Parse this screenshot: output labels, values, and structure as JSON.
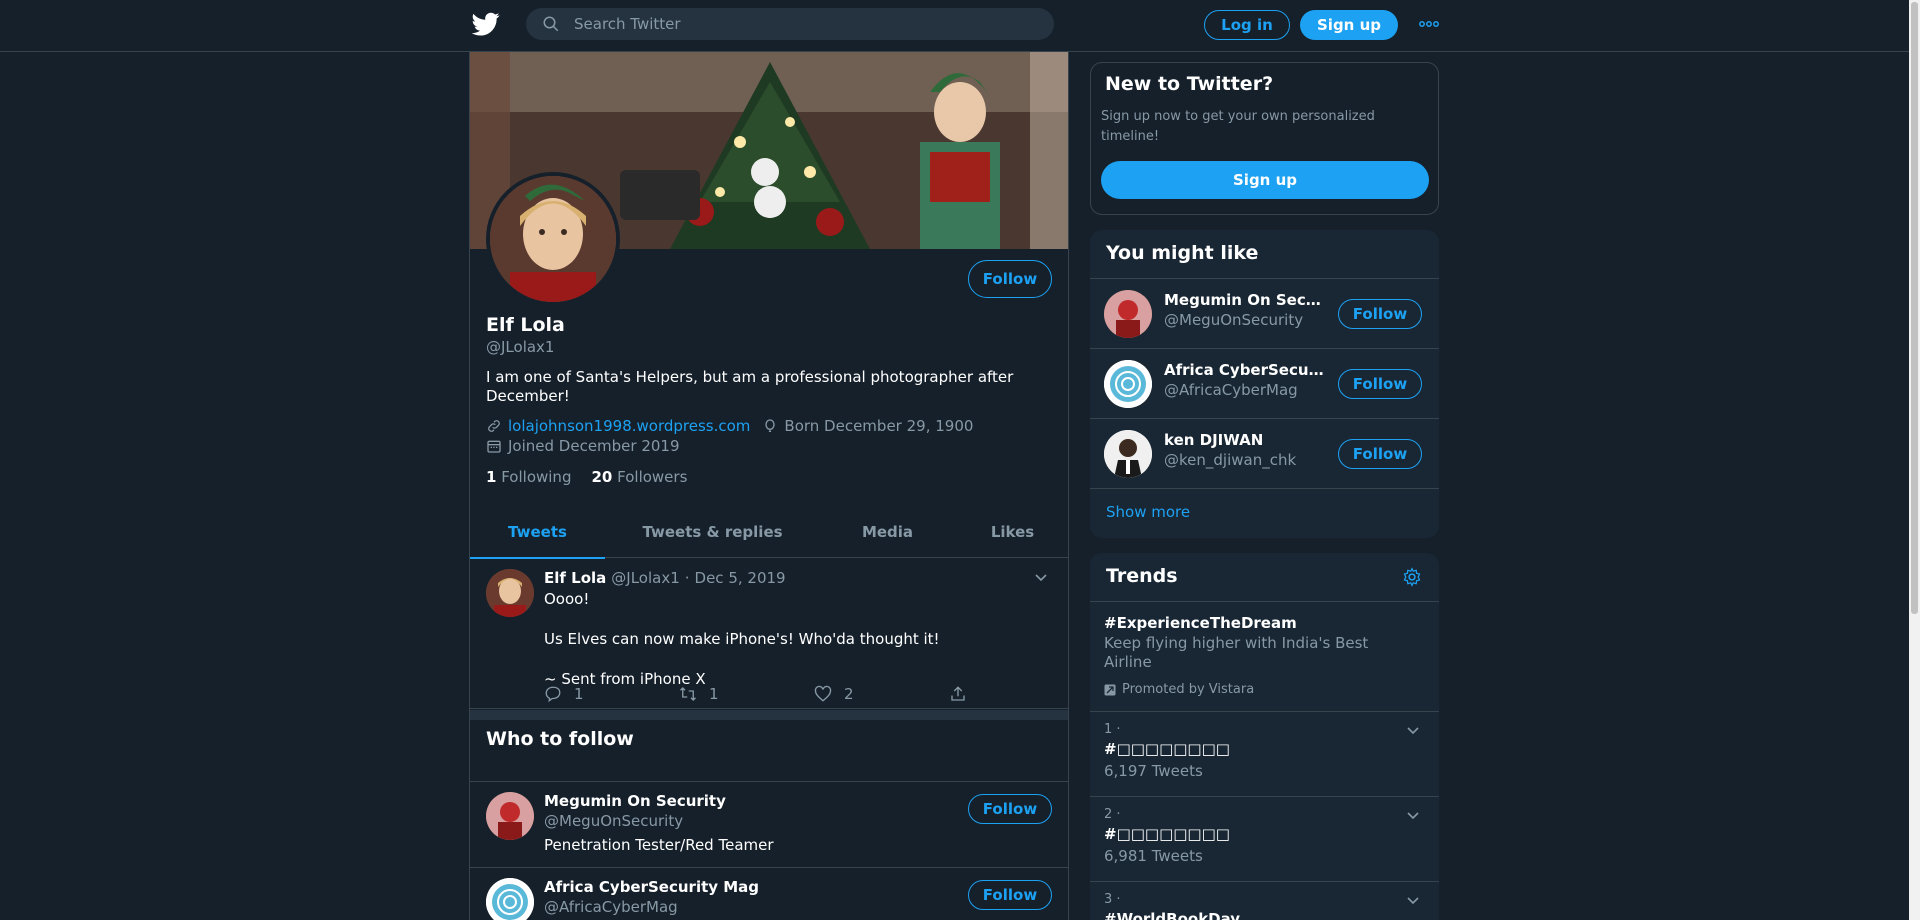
{
  "header": {
    "search_placeholder": "Search Twitter",
    "login_label": "Log in",
    "signup_label": "Sign up"
  },
  "profile": {
    "name": "Elf Lola",
    "handle": "@JLolax1",
    "follow_label": "Follow",
    "bio": "I am one of Santa's Helpers, but am a professional photographer after December!",
    "website": "lolajohnson1998.wordpress.com",
    "born": "Born December 29, 1900",
    "joined": "Joined December 2019",
    "following_count": "1",
    "following_label": "Following",
    "followers_count": "20",
    "followers_label": "Followers"
  },
  "tabs": [
    {
      "label": "Tweets",
      "active": true
    },
    {
      "label": "Tweets & replies",
      "active": false
    },
    {
      "label": "Media",
      "active": false
    },
    {
      "label": "Likes",
      "active": false
    }
  ],
  "tweet": {
    "name": "Elf Lola",
    "handle": "@JLolax1",
    "sep": "·",
    "date": "Dec 5, 2019",
    "lines": [
      "Oooo!",
      "Us Elves can now make iPhone's! Who'da thought it!",
      "~ Sent from iPhone X"
    ],
    "replies": "1",
    "retweets": "1",
    "likes": "2"
  },
  "who_to_follow": {
    "title": "Who to follow",
    "items": [
      {
        "name": "Megumin On Security",
        "handle": "@MeguOnSecurity",
        "desc": "Penetration Tester/Red Teamer",
        "follow": "Follow"
      },
      {
        "name": "Africa CyberSecurity Mag",
        "handle": "@AfricaCyberMag",
        "desc": "",
        "follow": "Follow"
      }
    ]
  },
  "new_to_twitter": {
    "title": "New to Twitter?",
    "text": "Sign up now to get your own personalized timeline!",
    "signup_label": "Sign up"
  },
  "you_might_like": {
    "title": "You might like",
    "items": [
      {
        "name": "Megumin On Security",
        "handle": "@MeguOnSecurity",
        "follow": "Follow"
      },
      {
        "name": "Africa CyberSecurity Mag",
        "handle": "@AfricaCyberMag",
        "follow": "Follow"
      },
      {
        "name": "ken DJIWAN",
        "handle": "@ken_djiwan_chk",
        "follow": "Follow"
      }
    ],
    "show_more": "Show more"
  },
  "trends": {
    "title": "Trends",
    "promoted": {
      "tag": "#ExperienceTheDream",
      "desc": "Keep flying higher with India's Best Airline",
      "promoted_by": "Promoted by Vistara"
    },
    "items": [
      {
        "rank": "1 ·",
        "tag": "#□□□□□□□□",
        "count": "6,197 Tweets"
      },
      {
        "rank": "2 ·",
        "tag": "#□□□□□□□□",
        "count": "6,981 Tweets"
      },
      {
        "rank": "3 ·",
        "tag": "#WorldBookDay",
        "count": ""
      }
    ]
  },
  "colors": {
    "background": "#15202b",
    "accent": "#1da1f2",
    "secondary_text": "#8899a6",
    "border": "#38444d"
  }
}
